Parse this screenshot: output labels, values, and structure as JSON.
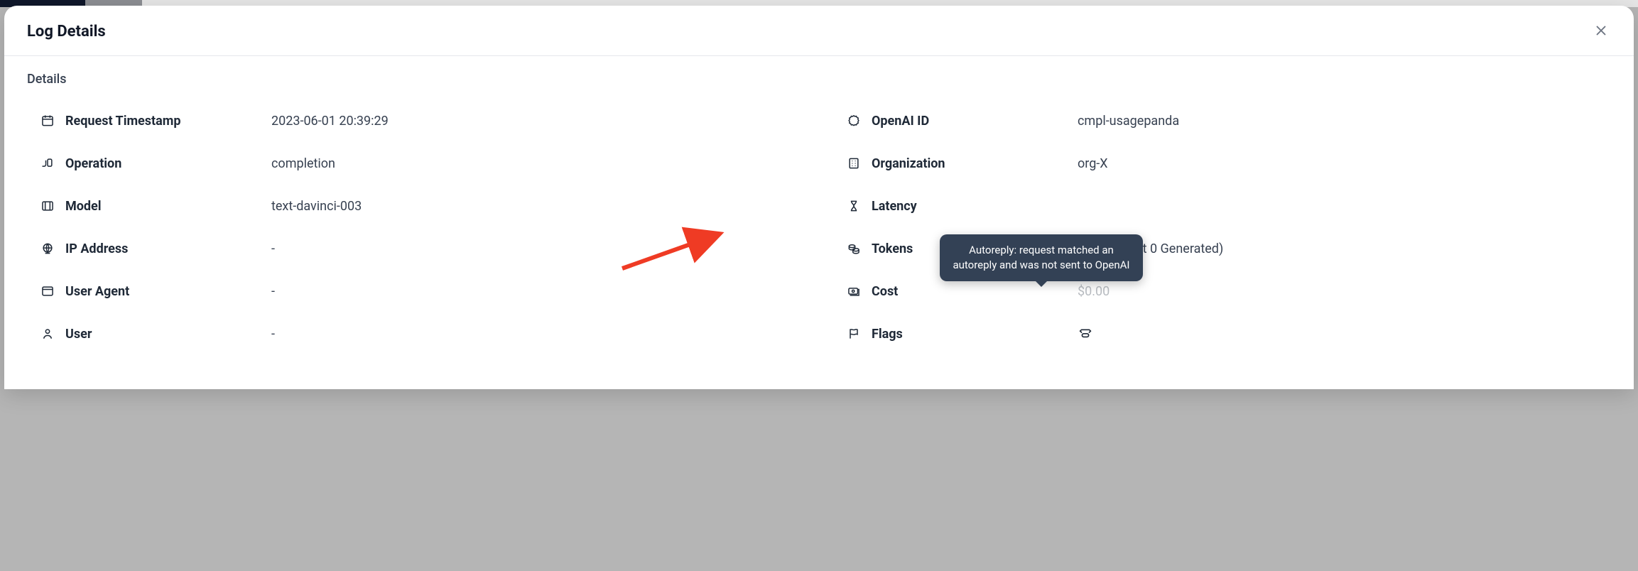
{
  "header": {
    "title": "Log Details"
  },
  "section_title": "Details",
  "left": {
    "request_timestamp": {
      "label": "Request Timestamp",
      "value": "2023-06-01 20:39:29"
    },
    "operation": {
      "label": "Operation",
      "value": "completion"
    },
    "model": {
      "label": "Model",
      "value": "text-davinci-003"
    },
    "ip_address": {
      "label": "IP Address",
      "value": "-"
    },
    "user_agent": {
      "label": "User Agent",
      "value": "-"
    },
    "user": {
      "label": "User",
      "value": "-"
    }
  },
  "right": {
    "openai_id": {
      "label": "OpenAI ID",
      "value": "cmpl-usagepanda"
    },
    "organization": {
      "label": "Organization",
      "value": "org-X"
    },
    "latency": {
      "label": "Latency",
      "value": ""
    },
    "tokens": {
      "label": "Tokens",
      "value": "0 (0 Context 0 Generated)"
    },
    "cost": {
      "label": "Cost",
      "value": "$0.00"
    },
    "flags": {
      "label": "Flags"
    }
  },
  "tooltip": {
    "text": "Autoreply: request matched an autoreply and was not sent to OpenAI"
  }
}
